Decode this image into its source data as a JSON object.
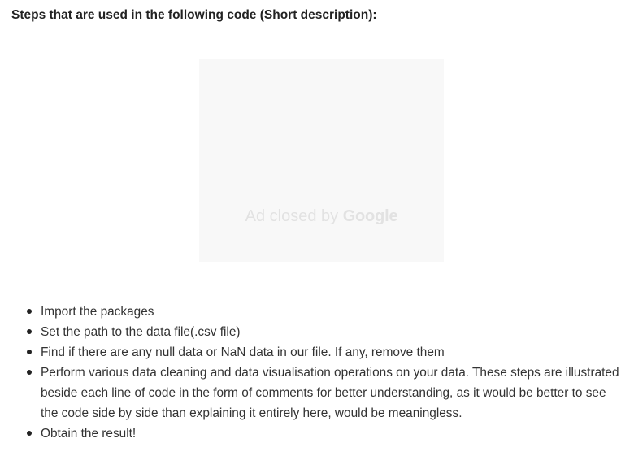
{
  "heading": "Steps that are used in the following code (Short description):",
  "ad": {
    "prefix": "Ad closed by",
    "brand": "Google"
  },
  "steps": [
    "Import the packages",
    "Set the path to the data file(.csv file)",
    "Find if there are any null data or NaN data in our file. If any, remove them",
    "Perform various data cleaning and data visualisation operations on your data. These steps are illustrated beside each line of code in the form of comments for better understanding, as it would be better to see the code side by side than explaining it entirely here, would be meaningless.",
    "Obtain the result!"
  ]
}
